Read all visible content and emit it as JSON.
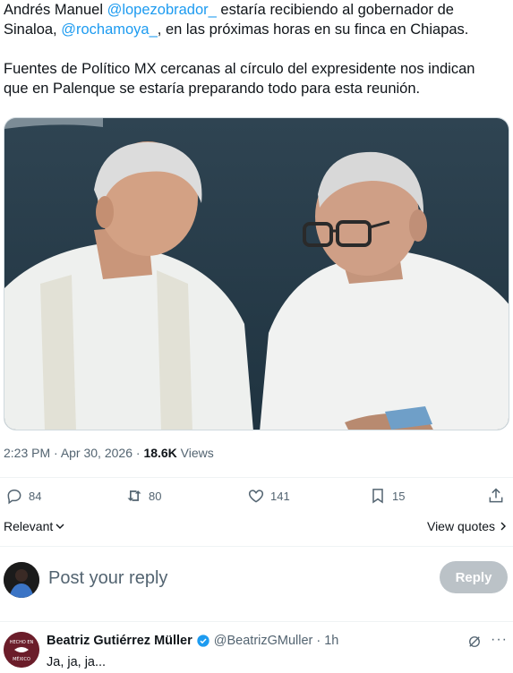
{
  "tweet": {
    "line1_pre": "Andrés Manuel ",
    "mention1": "@lopezobrador_",
    "line1_post": " estaría recibiendo al gobernador de",
    "line2_pre": "Sinaloa, ",
    "mention2": "@rochamoya_",
    "line2_post": ", en las próximas horas en su finca en Chiapas.",
    "para2_line1": "Fuentes de Político MX cercanas al círculo del expresidente nos indican",
    "para2_line2": "que en Palenque se estaría preparando todo para esta reunión."
  },
  "meta": {
    "time": "2:23 PM",
    "sep": " · ",
    "date": "Apr 30, 2026",
    "views_count": "18.6K",
    "views_label": " Views"
  },
  "actions": {
    "replies": "84",
    "reposts": "80",
    "likes": "141",
    "bookmarks": "15"
  },
  "sort": {
    "label": "Relevant",
    "view_quotes": "View quotes"
  },
  "reply_box": {
    "placeholder": "Post your reply",
    "button": "Reply"
  },
  "comment": {
    "name": "Beatriz Gutiérrez Müller",
    "handle": "@BeatrizGMuller",
    "time": "· 1h",
    "text": "Ja, ja, ja...",
    "avatar_text_top": "HECHO EN",
    "avatar_text_bottom": "MÉXICO"
  },
  "colors": {
    "accent": "#1d9bf0",
    "secondary_text": "#536471",
    "verified": "#1d9bf0"
  }
}
